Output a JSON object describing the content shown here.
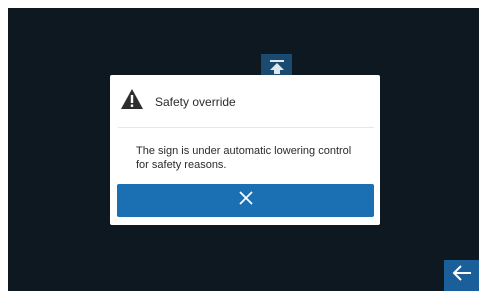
{
  "dialog": {
    "icon": "warning-icon",
    "title": "Safety override",
    "message": "The sign is under automatic lowering control for safety reasons.",
    "close_icon": "close-icon"
  },
  "background_controls": {
    "raise_icon": "raise-to-top-icon",
    "back_icon": "back-arrow-icon"
  },
  "colors": {
    "screen_background": "#0e1820",
    "accent_blue": "#1b6fb3",
    "dim_blue": "#1a4a70",
    "dialog_background": "#ffffff",
    "text": "#2b2b2b"
  }
}
